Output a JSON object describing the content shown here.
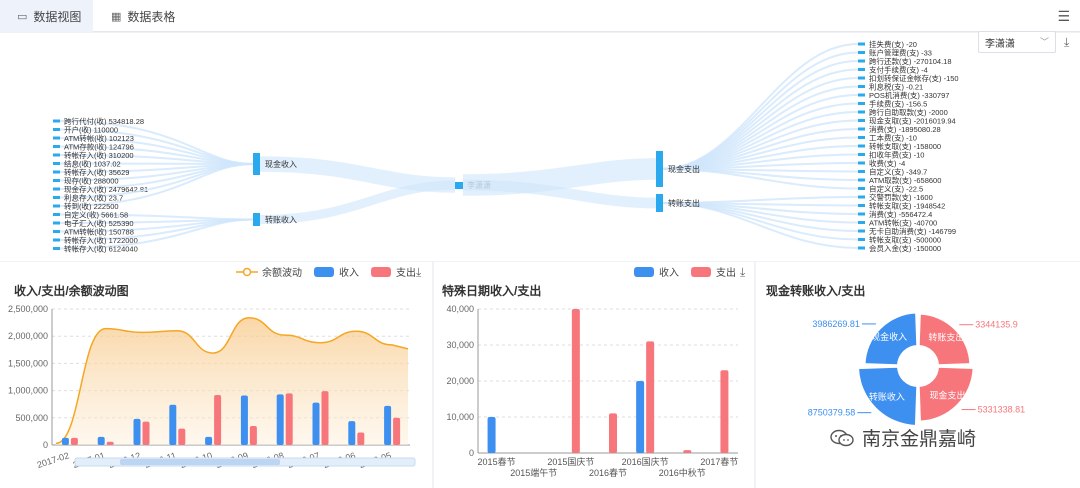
{
  "tabs": [
    {
      "label": "数据视图",
      "icon": "chart-view-icon",
      "active": true
    },
    {
      "label": "数据表格",
      "icon": "grid-table-icon",
      "active": false
    }
  ],
  "selector": {
    "value": "李潇潇"
  },
  "sankey": {
    "center": "李潇潇",
    "left_groups": [
      {
        "label": "现金收入",
        "items": [
          "跨行代付(收) 534818.28",
          "开户(收) 110000",
          "ATM转帐(收) 102123",
          "ATM存款(收) 124796",
          "转帐存入(收) 310200",
          "结息(收) 1037.02",
          "转帐存入(收) 35629",
          "现存(收) 288000",
          "现金存入(收) 2479642.81",
          "利息存入(收) 23.7",
          "转到(收) 222500"
        ]
      },
      {
        "label": "转账收入",
        "items": [
          "自定义(收) 5661.58",
          "电子汇入(收) 525390",
          "ATM转帐(收) 150788",
          "转帐存入(收) 1722000",
          "转帐存入(收) 6124040"
        ]
      }
    ],
    "right_groups": [
      {
        "label": "现金支出",
        "items": [
          "挂失费(支) -20",
          "账户管理费(支) -33",
          "跨行还款(支) -270104.18",
          "支付手续费(支) -4",
          "扣划转保证金帐存(支) -150",
          "利息税(支) -0.21",
          "POS机消费(支) -330797",
          "手续费(支) -156.5",
          "跨行自助取款(支) -2000",
          "现金支取(支) -2016019.94",
          "消费(支) -1895080.28",
          "工本费(支) -10",
          "转帐支取(支) -158000",
          "扣收年费(支) -10",
          "收费(支) -4",
          "自定义(支) -349.7",
          "ATM取款(支) -658600",
          "自定义(支) -22.5"
        ]
      },
      {
        "label": "转账支出",
        "items": [
          "交警罚款(支) -1600",
          "转帐支取(支) -1948542",
          "消费(支) -556472.4",
          "ATM转帐(支) -40700",
          "无卡自助消费(支) -146799",
          "转帐支取(支) -500000",
          "会员入金(支) -150000"
        ]
      }
    ]
  },
  "legends": {
    "chart1": [
      "余额波动",
      "收入",
      "支出"
    ],
    "chart2": [
      "收入",
      "支出"
    ]
  },
  "colors": {
    "income": "#3d8ff0",
    "expense": "#f7767b",
    "balance": "#f5a623",
    "node": "#2aa9ef"
  },
  "chart_data": [
    {
      "type": "bar",
      "title": "收入/支出/余额波动图",
      "categories": [
        "2017-02",
        "2017-01",
        "2016-12",
        "2016-11",
        "2016-10",
        "2016-09",
        "2016-08",
        "2016-07",
        "2016-06",
        "2016-05"
      ],
      "tick_labels": [
        "2017-02",
        "2017-01",
        "2016-12",
        "2016-11",
        "2016-10",
        "2016-09",
        "2016-08",
        "2016-07",
        "2016-06",
        "2016-05"
      ],
      "yticks": [
        "0",
        "500,000",
        "1,000,000",
        "1,500,000",
        "2,000,000",
        "2,500,000"
      ],
      "ylim": [
        0,
        2500000
      ],
      "series": [
        {
          "name": "收入",
          "type": "bar",
          "values": [
            130000,
            150000,
            480000,
            740000,
            150000,
            910000,
            930000,
            780000,
            440000,
            720000
          ]
        },
        {
          "name": "支出",
          "type": "bar",
          "values": [
            130000,
            60000,
            430000,
            300000,
            920000,
            350000,
            950000,
            990000,
            230000,
            500000
          ]
        },
        {
          "name": "余额波动",
          "type": "area",
          "values": [
            30000,
            2140000,
            2070000,
            2100000,
            1690000,
            2340000,
            2020000,
            1880000,
            2090000,
            1840000
          ]
        }
      ],
      "grid": true,
      "legend": "top-right"
    },
    {
      "type": "bar",
      "title": "特殊日期收入/支出",
      "categories": [
        "2015春节",
        "2015端午节",
        "2015国庆节",
        "2016春节",
        "2016国庆节",
        "2016中秋节",
        "2017春节"
      ],
      "tick_labels": [
        "2015春节",
        "2015端午节",
        "2015国庆节",
        "2016春节",
        "2016国庆节",
        "2016中秋节",
        "2017春节"
      ],
      "yticks": [
        "0",
        "10,000",
        "20,000",
        "30,000",
        "40,000"
      ],
      "ylim": [
        0,
        40000
      ],
      "series": [
        {
          "name": "收入",
          "values": [
            10000,
            0,
            0,
            0,
            20000,
            0,
            0
          ]
        },
        {
          "name": "支出",
          "values": [
            0,
            0,
            40000,
            11000,
            31000,
            800,
            23000
          ]
        }
      ],
      "grid": true,
      "legend": "top-right"
    },
    {
      "type": "pie",
      "title": "现金转账收入/支出",
      "labels": [
        "现金收入",
        "现金支出",
        "转账收入",
        "转账支出"
      ],
      "slice_names": [
        "现金收入",
        "现金支出",
        "转账收入",
        "转账支出"
      ],
      "values": [
        3986269.81,
        5331338.81,
        8750379.58,
        3344135.9
      ],
      "value_labels": [
        "3986269.81",
        "5331338.81",
        "8750379.58",
        "3344135.9"
      ],
      "colors": [
        "#3d8ff0",
        "#f7767b",
        "#3d8ff0",
        "#f7767b"
      ]
    }
  ],
  "watermark": {
    "text": "南京金鼎嘉崎"
  }
}
